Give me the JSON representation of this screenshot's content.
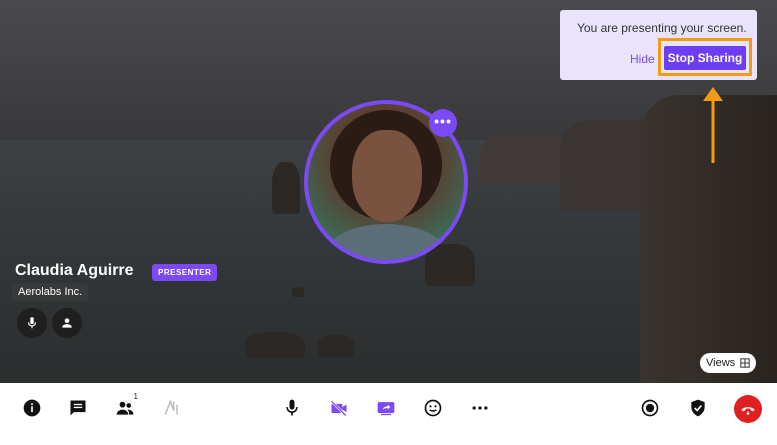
{
  "toast": {
    "message": "You are presenting your screen.",
    "hide_label": "Hide",
    "stop_label": "Stop Sharing"
  },
  "presenter": {
    "name": "Claudia Aguirre",
    "badge": "PRESENTER",
    "company": "Aerolabs Inc."
  },
  "views_label": "Views",
  "toolbar": {
    "left": [
      "info-icon",
      "chat-icon",
      "participants-icon",
      "ai-icon"
    ],
    "participants_count": "1",
    "center": [
      "mic-icon",
      "camera-off-icon",
      "screen-share-icon",
      "emoji-icon",
      "more-icon"
    ],
    "right": [
      "record-icon",
      "security-icon",
      "end-call-icon"
    ]
  },
  "colors": {
    "accent": "#7b4af5",
    "highlight": "#f39c12",
    "end_call": "#e02020"
  }
}
